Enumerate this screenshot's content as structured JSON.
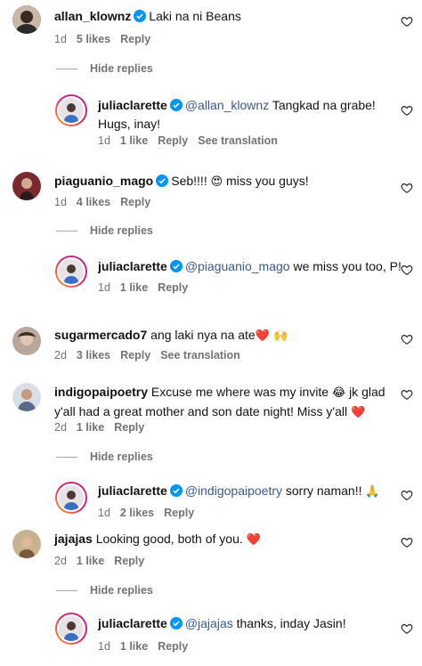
{
  "comments": [
    {
      "username": "allan_klownz",
      "text": "Laki na ni Beans",
      "time": "1d",
      "likes": "5 likes",
      "reply": "Reply"
    },
    {
      "username": "juliaclarette",
      "mention": "@allan_klownz",
      "text": "Tangkad na grabe! Hugs, inay!",
      "time": "1d",
      "likes": "1 like",
      "reply": "Reply",
      "translation": "See translation"
    },
    {
      "username": "piaguanio_mago",
      "text": "Seb!!!!",
      "emoji": "😍",
      "text2": "miss you guys!",
      "time": "1d",
      "likes": "4 likes",
      "reply": "Reply"
    },
    {
      "username": "juliaclarette",
      "mention": "@piaguanio_mago",
      "text": "we miss you too, P!",
      "time": "1d",
      "likes": "1 like",
      "reply": "Reply"
    },
    {
      "username": "sugarmercado7",
      "text": "ang laki nya na ate",
      "emoji": "❤️ 🙌",
      "time": "2d",
      "likes": "3 likes",
      "reply": "Reply",
      "translation": "See translation"
    },
    {
      "username": "indigopaipoetry",
      "text": "Excuse me where was my invite",
      "emoji": "😂",
      "text2": "jk glad y'all had a great mother and son date night! Miss y'all",
      "emoji2": "❤️",
      "time": "2d",
      "likes": "1 like",
      "reply": "Reply"
    },
    {
      "username": "juliaclarette",
      "mention": "@indigopaipoetry",
      "text": "sorry naman!!",
      "emoji": "🙏",
      "time": "1d",
      "likes": "2 likes",
      "reply": "Reply"
    },
    {
      "username": "jajajas",
      "text": "Looking good, both of you.",
      "emoji": "❤️",
      "time": "2d",
      "likes": "1 like",
      "reply": "Reply"
    },
    {
      "username": "juliaclarette",
      "mention": "@jajajas",
      "text": "thanks, inday Jasin!",
      "time": "1d",
      "likes": "1 like",
      "reply": "Reply"
    }
  ],
  "hide_replies_label": "Hide replies",
  "colors": {
    "verified": "#0095f6",
    "heart_emoji": "#e0245e",
    "meta": "#737373",
    "mention": "#3a5a8c"
  }
}
